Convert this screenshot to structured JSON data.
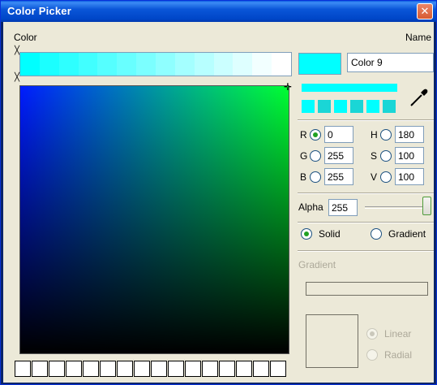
{
  "window": {
    "title": "Color Picker"
  },
  "labels": {
    "color": "Color",
    "name": "Name"
  },
  "history_bar": {
    "colors": [
      "#00ffff",
      "#1bffff",
      "#2effff",
      "#41ffff",
      "#55ffff",
      "#68ffff",
      "#7bffff",
      "#8fffff",
      "#a4ffff",
      "#b7ffff",
      "#cbffff",
      "#deffff",
      "#f2ffff",
      "#ffffff"
    ]
  },
  "current_color": "#00ffff",
  "name_field": {
    "value": "Color 9"
  },
  "rgb": {
    "r_label": "R",
    "r_value": "0",
    "g_label": "G",
    "g_value": "255",
    "b_label": "B",
    "b_value": "255"
  },
  "hsv": {
    "h_label": "H",
    "h_value": "180",
    "s_label": "S",
    "s_value": "100",
    "v_label": "V",
    "v_value": "100"
  },
  "alpha": {
    "label": "Alpha",
    "value": "255"
  },
  "fill_mode": {
    "solid_label": "Solid",
    "gradient_label": "Gradient",
    "selected": "Solid"
  },
  "gradient": {
    "title": "Gradient",
    "linear_label": "Linear",
    "radial_label": "Radial",
    "selected": "Linear"
  },
  "custom_slots": {
    "count": 16
  },
  "icons": {
    "close": "close-icon",
    "eyedropper": "eyedropper-icon"
  }
}
